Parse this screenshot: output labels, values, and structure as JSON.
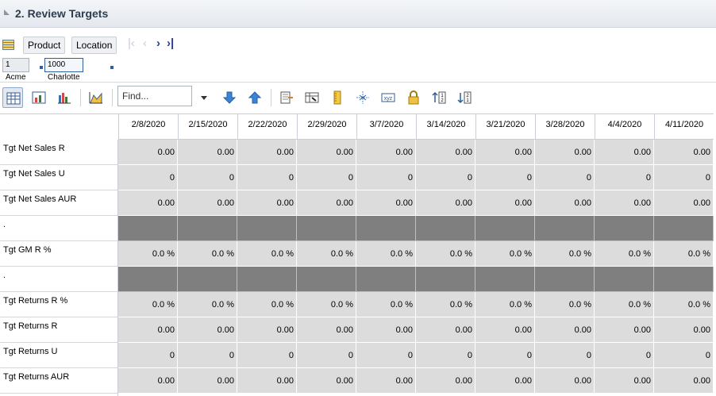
{
  "section": {
    "title": "2. Review Targets"
  },
  "dimensions": {
    "product": "Product",
    "location": "Location"
  },
  "breadcrumb": [
    "1 Acme",
    "1000 Charlotte"
  ],
  "toolbar": {
    "find_placeholder": "Find...",
    "icons": [
      "grid-view-icon",
      "chart-grid-icon",
      "bar-chart-icon",
      "area-chart-icon",
      "dropdown-arrow-icon",
      "arrow-down-icon",
      "arrow-up-icon",
      "export-icon",
      "column-select-icon",
      "ruler-icon",
      "collapse-icon",
      "xyz-icon",
      "lock-icon",
      "sort-ascending-icon",
      "sort-descending-icon"
    ]
  },
  "grid": {
    "columns": [
      "2/8/2020",
      "2/15/2020",
      "2/22/2020",
      "2/29/2020",
      "3/7/2020",
      "3/14/2020",
      "3/21/2020",
      "3/28/2020",
      "4/4/2020",
      "4/11/2020"
    ],
    "rows": [
      {
        "label": "Tgt Net Sales R",
        "value": "0.00",
        "dark": false
      },
      {
        "label": "Tgt Net Sales U",
        "value": "0",
        "dark": false
      },
      {
        "label": "Tgt Net Sales AUR",
        "value": "0.00",
        "dark": false
      },
      {
        "label": ".",
        "value": "",
        "dark": true
      },
      {
        "label": "Tgt GM R %",
        "value": "0.0 %",
        "dark": false
      },
      {
        "label": ".",
        "value": "",
        "dark": true
      },
      {
        "label": "Tgt Returns R %",
        "value": "0.0 %",
        "dark": false
      },
      {
        "label": "Tgt Returns R",
        "value": "0.00",
        "dark": false
      },
      {
        "label": "Tgt Returns U",
        "value": "0",
        "dark": false
      },
      {
        "label": "Tgt Returns AUR",
        "value": "0.00",
        "dark": false
      }
    ]
  }
}
